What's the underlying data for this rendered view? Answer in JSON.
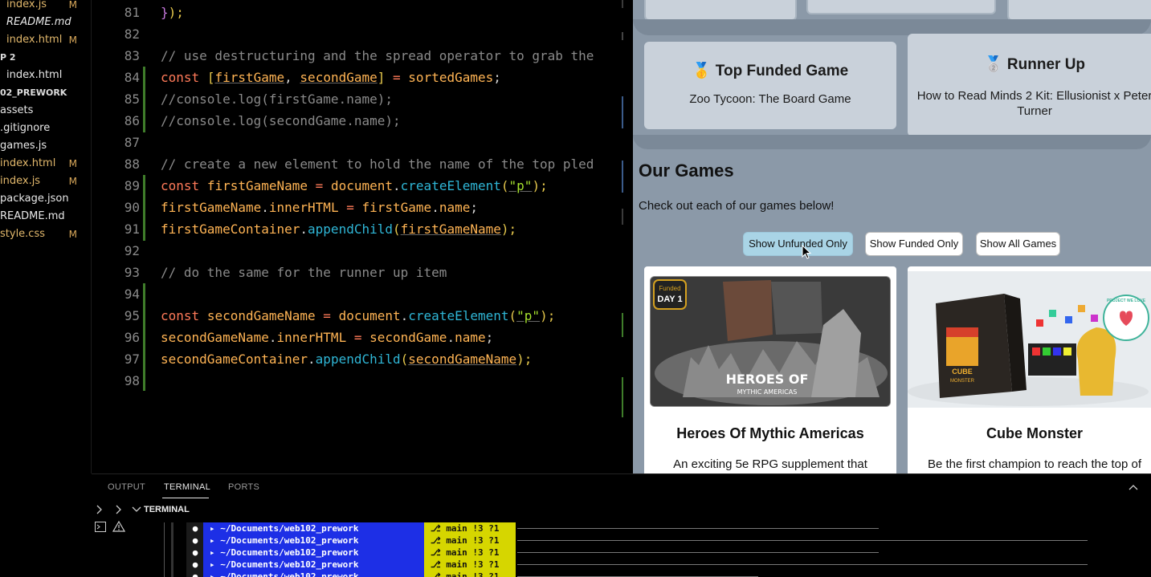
{
  "sidebar": {
    "items": [
      {
        "name": "index.js",
        "status": "M"
      },
      {
        "name": "README.md",
        "status": ""
      },
      {
        "name": "index.html",
        "status": "M"
      },
      {
        "name": "P 2",
        "status": ""
      },
      {
        "name": "index.html",
        "status": ""
      },
      {
        "name": "02_PREWORK",
        "status": ""
      },
      {
        "name": "assets",
        "status": ""
      },
      {
        "name": ".gitignore",
        "status": ""
      },
      {
        "name": "games.js",
        "status": ""
      },
      {
        "name": "index.html",
        "status": "M"
      },
      {
        "name": "index.js",
        "status": "M"
      },
      {
        "name": "package.json",
        "status": ""
      },
      {
        "name": "README.md",
        "status": ""
      },
      {
        "name": "style.css",
        "status": "M"
      }
    ]
  },
  "editor": {
    "line_numbers": [
      "81",
      "82",
      "83",
      "84",
      "85",
      "86",
      "87",
      "88",
      "89",
      "90",
      "91",
      "92",
      "93",
      "94",
      "95",
      "96",
      "97",
      "98"
    ],
    "code": {
      "l81_a": "}",
      "l81_b": ");",
      "l83": "// use destructuring and the spread operator to grab the",
      "l84_a": "const",
      "l84_b": "[",
      "l84_c": "firstGame",
      "l84_d": ", ",
      "l84_e": "secondGame",
      "l84_f": "]",
      "l84_g": " = ",
      "l84_h": "sortedGames",
      "l84_i": ";",
      "l85": "//console.log(firstGame.name);",
      "l86": "//console.log(secondGame.name);",
      "l88": "// create a new element to hold the name of the top pled",
      "l89_a": "const",
      "l89_b": "firstGameName",
      "l89_c": " = ",
      "l89_d": "document",
      "l89_e": ".",
      "l89_f": "createElement",
      "l89_g": "(",
      "l89_h": "\"p\"",
      "l89_i": ");",
      "l90_a": "firstGameName",
      "l90_b": ".",
      "l90_c": "innerHTML",
      "l90_d": " = ",
      "l90_e": "firstGame",
      "l90_f": ".",
      "l90_g": "name",
      "l90_h": ";",
      "l91_a": "firstGameContainer",
      "l91_b": ".",
      "l91_c": "appendChild",
      "l91_d": "(",
      "l91_e": "firstGameName",
      "l91_f": ");",
      "l93": "// do the same for the runner up item",
      "l95_a": "const",
      "l95_b": "secondGameName",
      "l95_c": " = ",
      "l95_d": "document",
      "l95_e": ".",
      "l95_f": "createElement",
      "l95_g": "(",
      "l95_h": "\"p\"",
      "l95_i": ");",
      "l96_a": "secondGameName",
      "l96_b": ".",
      "l96_c": "innerHTML",
      "l96_d": " = ",
      "l96_e": "secondGame",
      "l96_f": ".",
      "l96_g": "name",
      "l96_h": ";",
      "l97_a": "secondGameContainer",
      "l97_b": ".",
      "l97_c": "appendChild",
      "l97_d": "(",
      "l97_e": "secondGameName",
      "l97_f": ");"
    }
  },
  "preview": {
    "top_funded": {
      "icon": "🥇",
      "title": "Top Funded Game",
      "game": "Zoo Tycoon: The Board Game"
    },
    "runner_up": {
      "icon": "🥈",
      "title": "Runner Up",
      "game": "How to Read Minds 2 Kit: Ellusionist x Peter Turner"
    },
    "section_title": "Our Games",
    "section_desc": "Check out each of our games below!",
    "buttons": {
      "unfunded": "Show Unfunded Only",
      "funded": "Show Funded Only",
      "all": "Show All Games"
    },
    "games": [
      {
        "title": "Heroes Of Mythic Americas",
        "desc": "An exciting 5e RPG supplement that",
        "image_label": "HEROES OF",
        "image_sub": "MYTHIC AMERICAS",
        "badge": "DAY 1",
        "badge_small": "Funded"
      },
      {
        "title": "Cube Monster",
        "desc": "Be the first champion to reach the top of",
        "image_label": "CUBE",
        "image_sub": "MONSTER",
        "badge": "PROJECT WE LOVE"
      }
    ],
    "colors": {
      "page_bg": "#8b99a8",
      "card_bg": "#c9d1da",
      "active_button": "#a9d4e6"
    }
  },
  "panel": {
    "tabs": [
      "OUTPUT",
      "TERMINAL",
      "PORTS"
    ],
    "active_tab": "TERMINAL",
    "terminal_header": "TERMINAL",
    "prompt_path": "~/Documents/web102_prework",
    "prompt_branch": "main !3 ?1"
  }
}
